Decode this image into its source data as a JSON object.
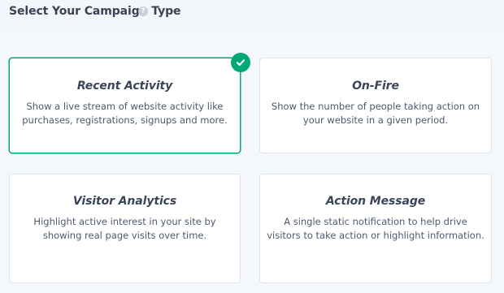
{
  "header": {
    "title": "Select Your Campaign Type",
    "help_icon": "?"
  },
  "cards": [
    {
      "title": "Recent Activity",
      "description": "Show a live stream of website activity like purchases, registrations, signups and more.",
      "selected": true
    },
    {
      "title": "On-Fire",
      "description": "Show the number of people taking action on your website in a given period.",
      "selected": false
    },
    {
      "title": "Visitor Analytics",
      "description": "Highlight active interest in your site by showing real page visits over time.",
      "selected": false
    },
    {
      "title": "Action Message",
      "description": "A single static notification to help drive visitors to take action or highlight information.",
      "selected": false
    }
  ],
  "colors": {
    "accent": "#00a877",
    "background": "#f4f7fb",
    "card_border": "#dfe5ee"
  },
  "icons": {
    "selected_check": "check-icon",
    "help": "help-circle-icon"
  }
}
